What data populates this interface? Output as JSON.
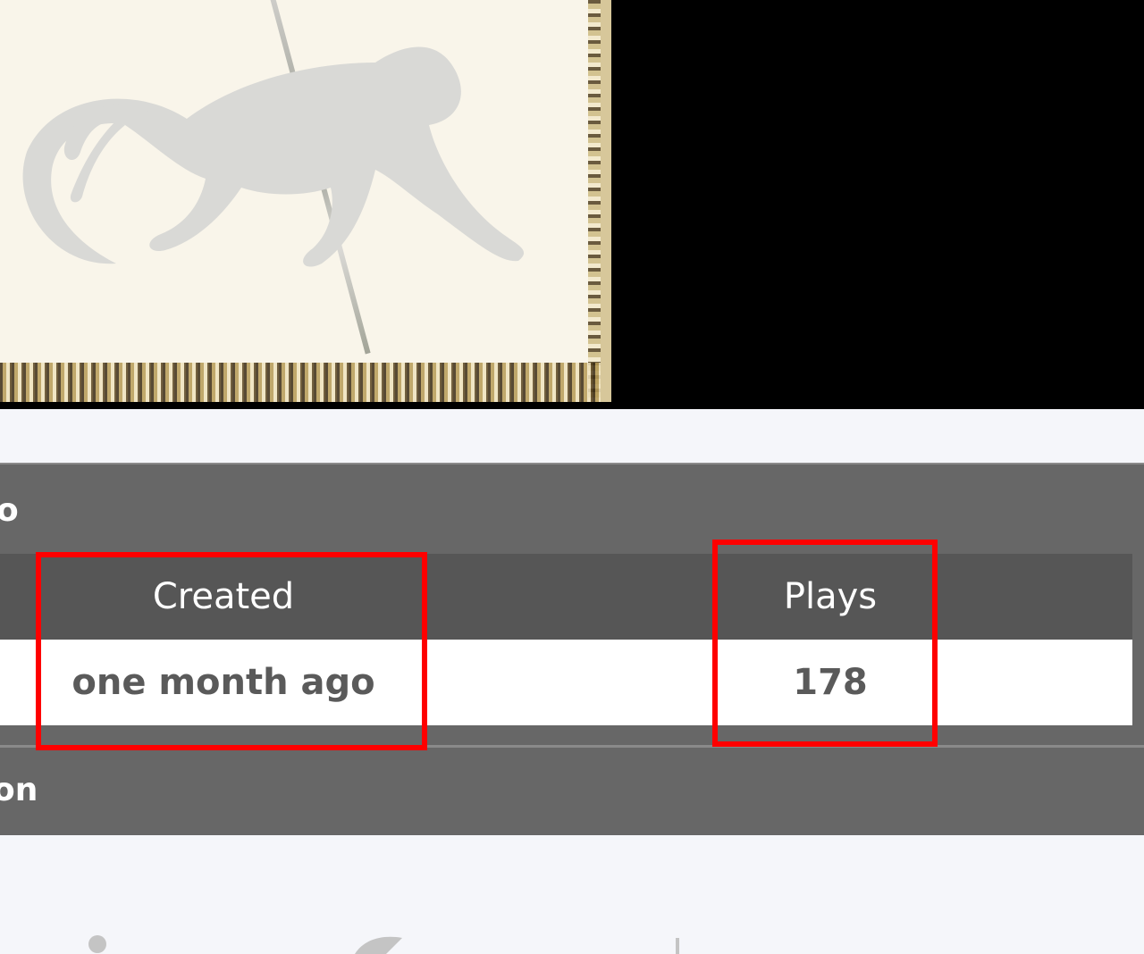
{
  "info": {
    "title": "o",
    "columns": [
      "Created",
      "Plays"
    ],
    "values": [
      "one month ago",
      "178"
    ]
  },
  "description": {
    "title": "on"
  },
  "media": {
    "cover_icon": "monkey-silhouette"
  },
  "footer": {
    "icons": [
      "person-icon",
      "leaf-icon",
      "pin-icon"
    ]
  },
  "colors": {
    "panel": "#676767",
    "header_row": "#565656",
    "highlight": "#ff0000"
  }
}
